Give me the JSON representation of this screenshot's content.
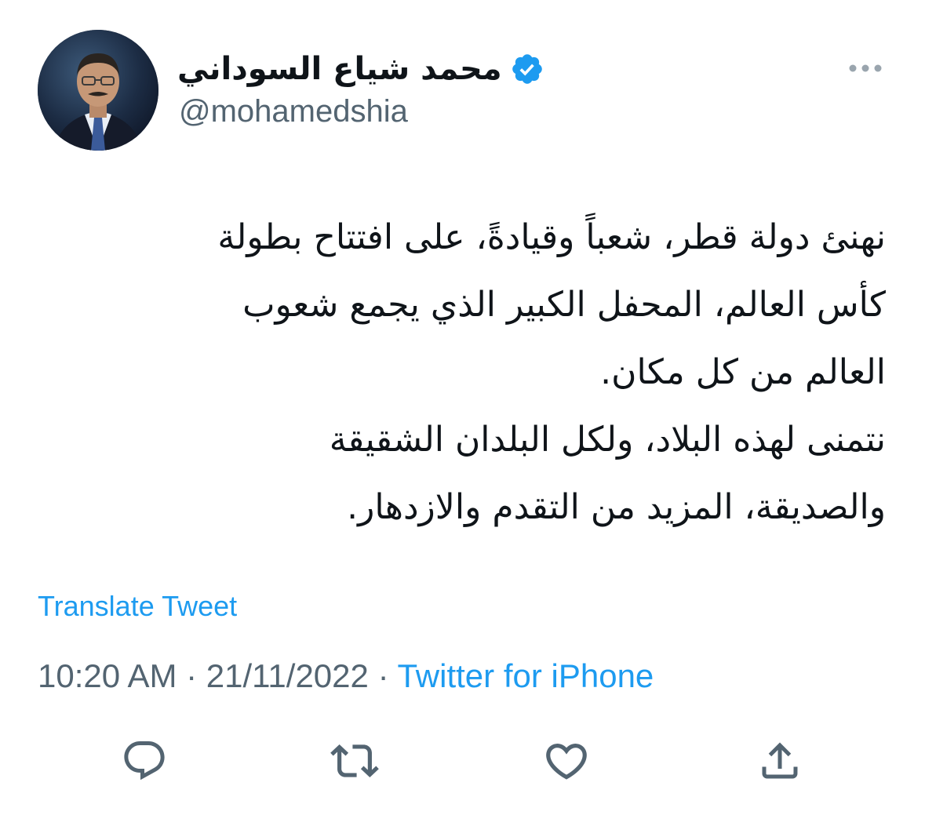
{
  "author": {
    "display_name": "محمد شياع السوداني",
    "handle": "@mohamedshia",
    "verified": true
  },
  "tweet": {
    "text": "نهنئ دولة قطر، شعباً وقيادةً، على افتتاح بطولة\nكأس العالم، المحفل الكبير الذي يجمع شعوب\nالعالم من كل مكان.\nنتمنى لهذه البلاد، ولكل البلدان الشقيقة\nوالصديقة، المزيد من التقدم والازدهار.",
    "translate_label": "Translate Tweet",
    "time": "10:20 AM",
    "separator": "·",
    "date": "21/11/2022",
    "source": "Twitter for iPhone"
  },
  "icons": {
    "more": "more-options-icon",
    "verified": "verified-badge-icon",
    "reply": "reply-icon",
    "retweet": "retweet-icon",
    "like": "like-icon",
    "share": "share-icon"
  },
  "colors": {
    "accent": "#1d9bf0",
    "secondary_text": "#536471",
    "icon_gray": "#536471",
    "text": "#0f1419"
  }
}
